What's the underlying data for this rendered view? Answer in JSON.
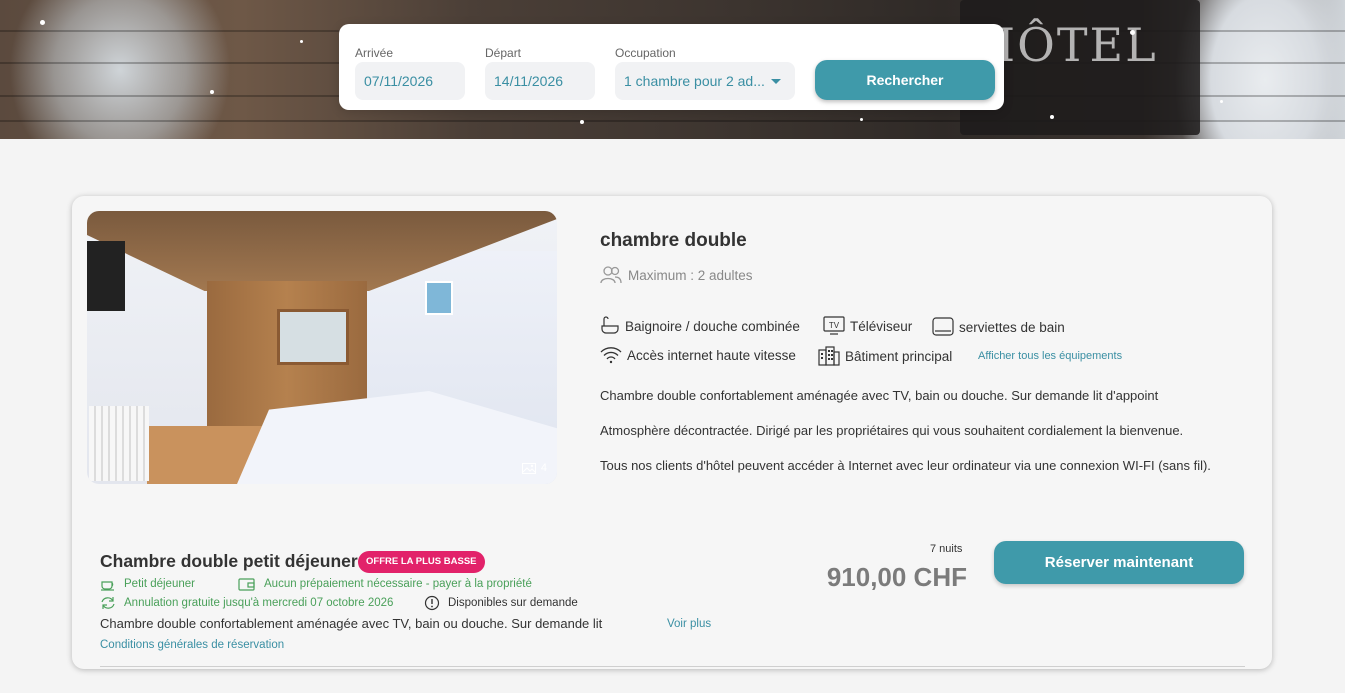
{
  "search": {
    "arrival_label": "Arrivée",
    "arrival_value": "07/11/2026",
    "departure_label": "Départ",
    "departure_value": "14/11/2026",
    "occupation_label": "Occupation",
    "occupation_value": "1 chambre pour 2 ad...",
    "search_button": "Rechercher"
  },
  "room": {
    "title": "chambre double",
    "max": "Maximum : 2 adultes",
    "photo_count": "4",
    "amenities": [
      {
        "label": "Baignoire / douche combinée",
        "icon": "bathtub-icon"
      },
      {
        "label": "Téléviseur",
        "icon": "tv-icon"
      },
      {
        "label": "serviettes de bain",
        "icon": "towel-icon"
      },
      {
        "label": "Accès internet haute vitesse",
        "icon": "wifi-icon"
      },
      {
        "label": "Bâtiment principal",
        "icon": "building-icon"
      }
    ],
    "show_all_amenities": "Afficher tous les équipements",
    "tv_icon_text": "TV",
    "descriptions": [
      "Chambre double confortablement aménagée avec TV, bain ou douche. Sur demande lit d'appoint",
      "Atmosphère décontractée. Dirigé par les propriétaires qui vous souhaitent cordialement la bienvenue.",
      "Tous nos clients d'hôtel peuvent accéder à Internet avec leur ordinateur via une connexion WI-FI (sans fil)."
    ]
  },
  "rate": {
    "title": "Chambre double petit déjeuner",
    "badge": "OFFRE LA PLUS BASSE",
    "breakfast": "Petit déjeuner",
    "prepayment": "Aucun prépaiement nécessaire - payer à la propriété",
    "cancellation": "Annulation gratuite jusqu'à mercredi 07 octobre 2026",
    "availability": "Disponibles sur demande",
    "description": "Chambre double confortablement aménagée avec TV, bain ou douche. Sur demande lit",
    "see_more": "Voir plus",
    "terms": "Conditions générales de réservation",
    "nights": "7 nuits",
    "price": "910,00 CHF",
    "book_button": "Réserver maintenant"
  },
  "hero": {
    "sign_text": "HÔTEL"
  },
  "colors": {
    "accent": "#3f9aaa",
    "badge": "#e2226a",
    "condition_green": "#4aa05a",
    "price_grey": "#7b7b7b"
  }
}
